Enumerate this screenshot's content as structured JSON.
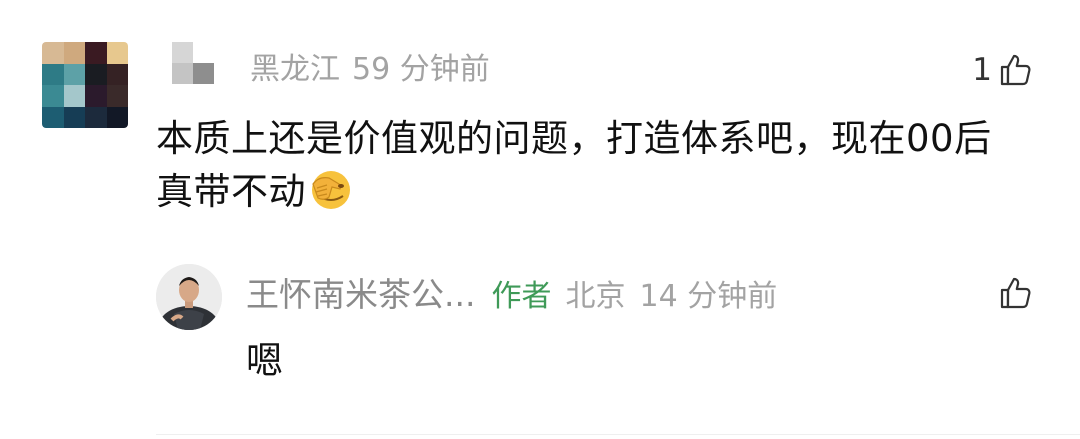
{
  "comment": {
    "avatar_icon": "pixelated-avatar",
    "username_icon": "pixelated-username",
    "location": "黑龙江",
    "time": "59 分钟前",
    "like_count": "1",
    "like_icon": "thumbs-up-icon",
    "text": "本质上还是价值观的问题，打造体系吧，现在00后真带不动",
    "emoji": "facepalm-emoji"
  },
  "reply": {
    "avatar_icon": "user-avatar-photo",
    "name": "王怀南米茶公...",
    "badge": "作者",
    "location": "北京",
    "time": "14 分钟前",
    "like_icon": "thumbs-up-icon",
    "text": "嗯"
  },
  "colors": {
    "meta_gray": "#a3a3a3",
    "author_green": "#3f9a58",
    "text_dark": "#111111"
  }
}
